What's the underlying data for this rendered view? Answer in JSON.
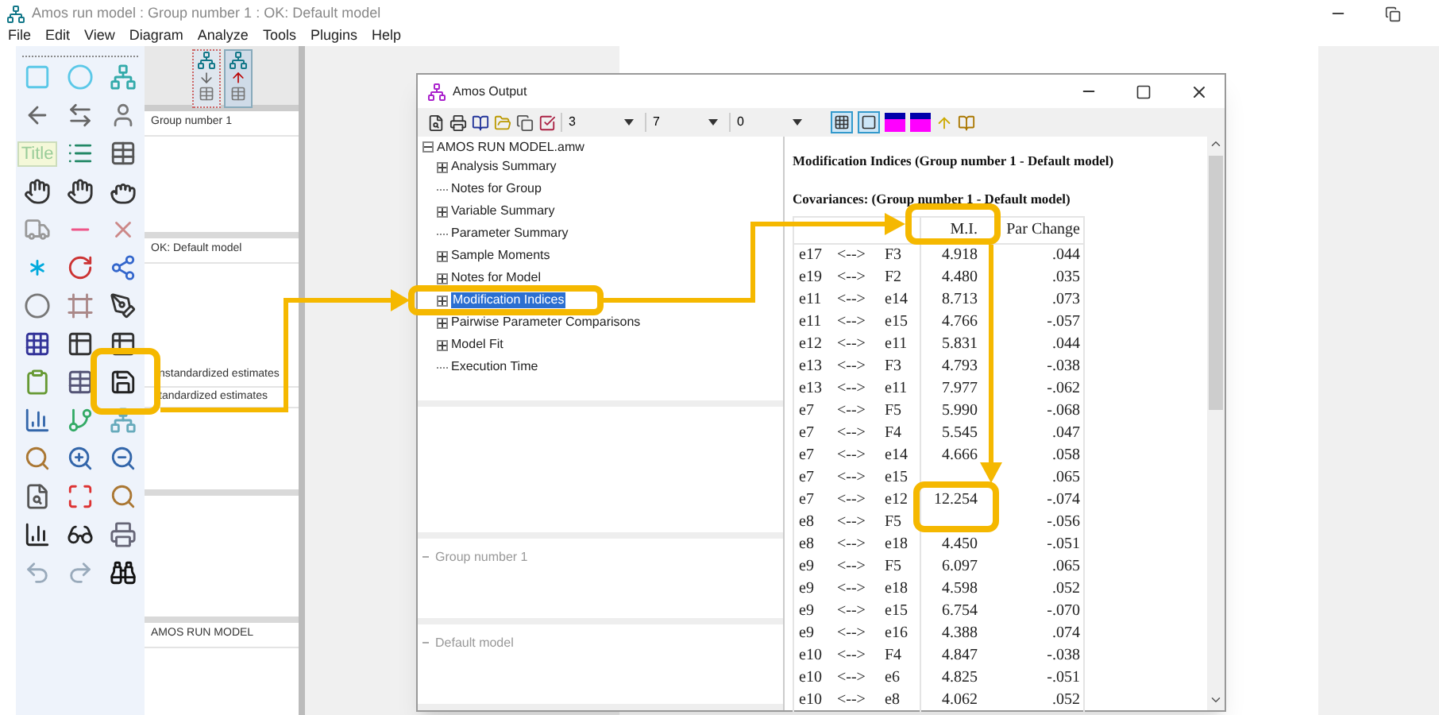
{
  "app_window": {
    "title": "Amos run model : Group number 1 : OK: Default model"
  },
  "menu": [
    "File",
    "Edit",
    "View",
    "Diagram",
    "Analyze",
    "Tools",
    "Plugins",
    "Help"
  ],
  "toolbox": {
    "title_tool": "Title"
  },
  "model_panels": {
    "group": "Group number 1",
    "model": "OK: Default model",
    "estimates": [
      "nstandardized estimates",
      "tandardized estimates"
    ],
    "file": "AMOS RUN MODEL"
  },
  "output_window": {
    "title": "Amos Output",
    "dropdowns": [
      "3",
      "7",
      "0"
    ],
    "tree": {
      "label": "AMOS RUN MODEL.amw",
      "expanded": true,
      "children": [
        {
          "label": "Analysis Summary",
          "expandable": true,
          "selected": false
        },
        {
          "label": "Notes for Group",
          "expandable": false,
          "selected": false
        },
        {
          "label": "Variable Summary",
          "expandable": true,
          "selected": false
        },
        {
          "label": "Parameter Summary",
          "expandable": false,
          "selected": false
        },
        {
          "label": "Sample Moments",
          "expandable": true,
          "selected": false
        },
        {
          "label": "Notes for Model",
          "expandable": true,
          "selected": false
        },
        {
          "label": "Modification Indices",
          "expandable": true,
          "selected": true
        },
        {
          "label": "Pairwise Parameter Comparisons",
          "expandable": true,
          "selected": false
        },
        {
          "label": "Model Fit",
          "expandable": true,
          "selected": false
        },
        {
          "label": "Execution Time",
          "expandable": false,
          "selected": false
        }
      ]
    },
    "lower_panels": [
      "Group number 1",
      "Default model"
    ],
    "report": {
      "title": "Modification Indices (Group number 1 - Default model)",
      "section": "Covariances: (Group number 1 - Default model)",
      "columns": [
        "M.I.",
        "Par Change"
      ],
      "rows": [
        {
          "from": "e17",
          "link": "<-->",
          "to": "F3",
          "mi": "4.918",
          "par_change": ".044"
        },
        {
          "from": "e19",
          "link": "<-->",
          "to": "F2",
          "mi": "4.480",
          "par_change": ".035"
        },
        {
          "from": "e11",
          "link": "<-->",
          "to": "e14",
          "mi": "8.713",
          "par_change": ".073"
        },
        {
          "from": "e11",
          "link": "<-->",
          "to": "e15",
          "mi": "4.766",
          "par_change": "-.057"
        },
        {
          "from": "e12",
          "link": "<-->",
          "to": "e11",
          "mi": "5.831",
          "par_change": ".044"
        },
        {
          "from": "e13",
          "link": "<-->",
          "to": "F3",
          "mi": "4.793",
          "par_change": "-.038"
        },
        {
          "from": "e13",
          "link": "<-->",
          "to": "e11",
          "mi": "7.977",
          "par_change": "-.062"
        },
        {
          "from": "e7",
          "link": "<-->",
          "to": "F5",
          "mi": "5.990",
          "par_change": "-.068"
        },
        {
          "from": "e7",
          "link": "<-->",
          "to": "F4",
          "mi": "5.545",
          "par_change": ".047"
        },
        {
          "from": "e7",
          "link": "<-->",
          "to": "e14",
          "mi": "4.666",
          "par_change": ".058"
        },
        {
          "from": "e7",
          "link": "<-->",
          "to": "e15",
          "par_change": ".065"
        },
        {
          "from": "e7",
          "link": "<-->",
          "to": "e12",
          "mi": "12.254",
          "par_change": "-.074"
        },
        {
          "from": "e8",
          "link": "<-->",
          "to": "F5",
          "par_change": "-.056"
        },
        {
          "from": "e8",
          "link": "<-->",
          "to": "e18",
          "mi": "4.450",
          "par_change": "-.051"
        },
        {
          "from": "e9",
          "link": "<-->",
          "to": "F5",
          "mi": "6.097",
          "par_change": ".065"
        },
        {
          "from": "e9",
          "link": "<-->",
          "to": "e18",
          "mi": "4.598",
          "par_change": ".052"
        },
        {
          "from": "e9",
          "link": "<-->",
          "to": "e15",
          "mi": "6.754",
          "par_change": "-.070"
        },
        {
          "from": "e9",
          "link": "<-->",
          "to": "e16",
          "mi": "4.388",
          "par_change": ".074"
        },
        {
          "from": "e10",
          "link": "<-->",
          "to": "F4",
          "mi": "4.847",
          "par_change": "-.038"
        },
        {
          "from": "e10",
          "link": "<-->",
          "to": "e6",
          "mi": "4.825",
          "par_change": "-.051"
        },
        {
          "from": "e10",
          "link": "<-->",
          "to": "e8",
          "mi": "4.062",
          "par_change": ".052"
        }
      ]
    }
  }
}
